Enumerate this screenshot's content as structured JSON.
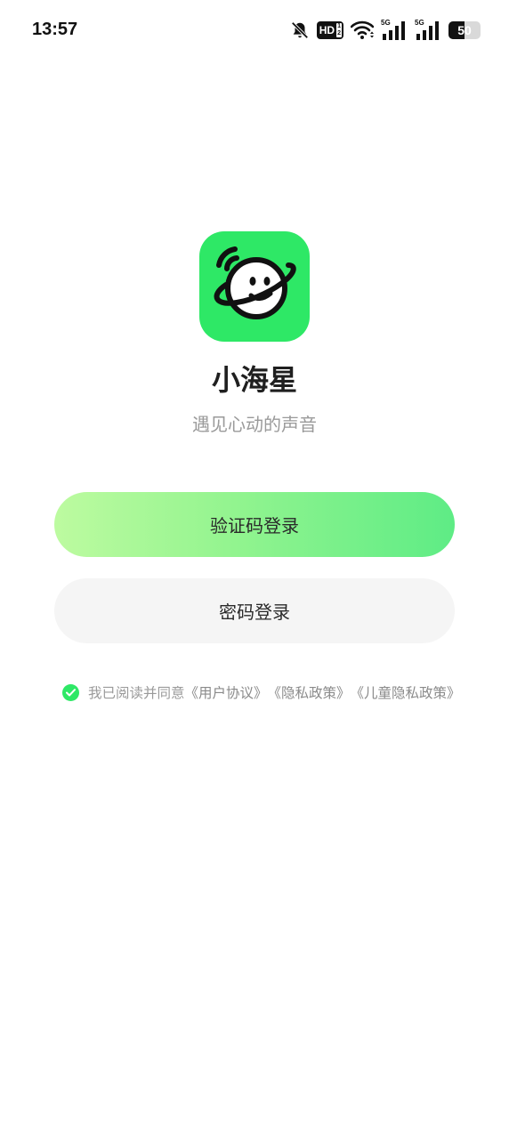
{
  "status_bar": {
    "time": "13:57",
    "icons": [
      "bell-muted-icon",
      "hd-icon",
      "wifi-icon",
      "signal-5g-icon",
      "signal-5g-icon",
      "battery-icon"
    ],
    "hd_label": "HD",
    "hd_sub_top": "1",
    "hd_sub_bottom": "2",
    "net1_label": "5G",
    "net2_label": "5G",
    "battery_level": "50"
  },
  "app": {
    "name": "小海星",
    "slogan": "遇见心动的声音",
    "brand_color": "#2ee866"
  },
  "buttons": {
    "sms_login": "验证码登录",
    "password_login": "密码登录"
  },
  "agreement": {
    "prefix": "我已阅读并同意",
    "user_agreement": "《用户协议》",
    "privacy_policy": "《隐私政策》",
    "child_privacy_policy": "《儿童隐私政策》",
    "checked": true
  }
}
